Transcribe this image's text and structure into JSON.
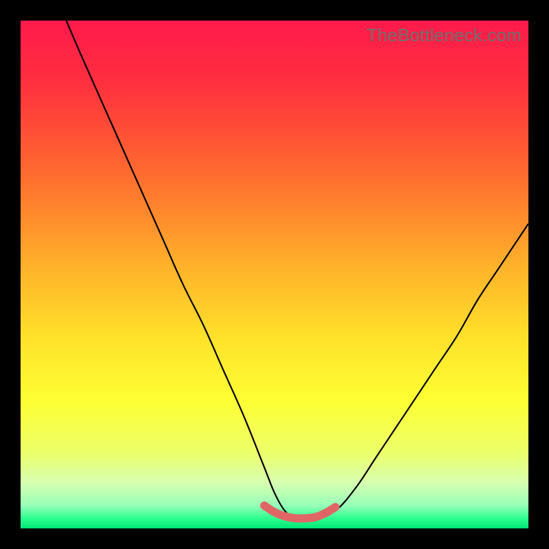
{
  "watermark": "TheBottleneck.com",
  "chart_data": {
    "type": "line",
    "title": "",
    "xlabel": "",
    "ylabel": "",
    "xlim": [
      0,
      100
    ],
    "ylim": [
      0,
      100
    ],
    "grid": false,
    "legend": false,
    "series": [
      {
        "name": "bottleneck-v-curve",
        "x": [
          9,
          12,
          16,
          20,
          24,
          28,
          32,
          36,
          40,
          44,
          48,
          50,
          52,
          54,
          56,
          58,
          62,
          66,
          70,
          74,
          78,
          82,
          86,
          90,
          94,
          98,
          100
        ],
        "y": [
          100,
          93,
          84,
          75,
          66,
          57,
          48,
          40,
          31,
          22,
          12,
          7,
          3.5,
          2,
          2,
          2,
          3.5,
          8,
          14,
          20,
          26,
          32,
          38,
          45,
          51,
          57,
          60
        ]
      },
      {
        "name": "flat-segment-marker",
        "x": [
          48,
          50,
          52,
          54,
          56,
          58,
          60,
          62
        ],
        "y": [
          4.5,
          3.2,
          2.4,
          2.0,
          2.0,
          2.2,
          3.0,
          4.2
        ]
      }
    ],
    "gradient_stops": [
      {
        "offset": 0.0,
        "color": "#ff1a4b"
      },
      {
        "offset": 0.12,
        "color": "#ff2f3f"
      },
      {
        "offset": 0.3,
        "color": "#ff6a2f"
      },
      {
        "offset": 0.48,
        "color": "#ffb02a"
      },
      {
        "offset": 0.62,
        "color": "#ffe02a"
      },
      {
        "offset": 0.75,
        "color": "#fdff33"
      },
      {
        "offset": 0.85,
        "color": "#ecff6a"
      },
      {
        "offset": 0.91,
        "color": "#d7ffb0"
      },
      {
        "offset": 0.955,
        "color": "#97ffb8"
      },
      {
        "offset": 0.98,
        "color": "#2fff8f"
      },
      {
        "offset": 1.0,
        "color": "#00e676"
      }
    ]
  }
}
